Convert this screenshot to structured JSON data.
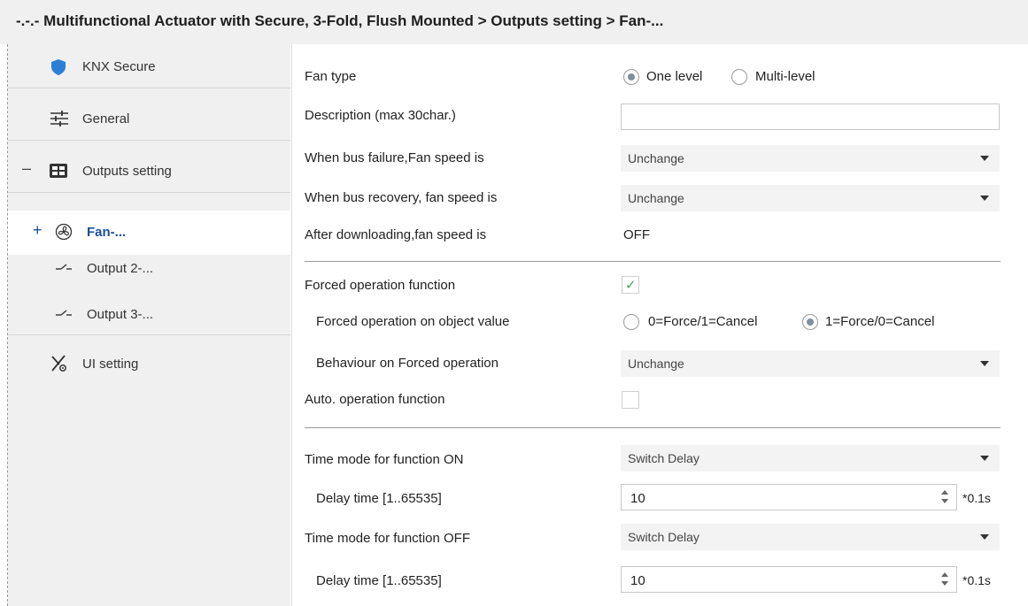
{
  "header": {
    "breadcrumb": "-.-.- Multifunctional Actuator with Secure, 3-Fold, Flush Mounted > Outputs setting > Fan-..."
  },
  "sidebar": {
    "items": [
      {
        "label": "KNX Secure",
        "icon": "shield-icon"
      },
      {
        "label": "General",
        "icon": "sliders-icon"
      },
      {
        "label": "Outputs setting",
        "icon": "grid-icon",
        "expander": "–"
      },
      {
        "label": "Fan-...",
        "icon": "fan-icon",
        "expander": "+",
        "selected": true
      },
      {
        "label": "Output 2-...",
        "icon": "switch-icon"
      },
      {
        "label": "Output 3-...",
        "icon": "switch-icon"
      },
      {
        "label": "UI setting",
        "icon": "settings-tool-icon"
      }
    ]
  },
  "form": {
    "fan_type": {
      "label": "Fan type",
      "options": [
        "One level",
        "Multi-level"
      ],
      "selected": "One level"
    },
    "description": {
      "label": "Description (max 30char.)",
      "value": ""
    },
    "bus_failure": {
      "label": "When bus failure,Fan speed is",
      "value": "Unchange"
    },
    "bus_recovery": {
      "label": "When bus recovery, fan speed is",
      "value": "Unchange"
    },
    "after_download": {
      "label": "After downloading,fan speed is",
      "value": "OFF"
    },
    "forced_function": {
      "label": "Forced operation function",
      "checked": true
    },
    "forced_object_value": {
      "label": "Forced operation on object value",
      "options": [
        "0=Force/1=Cancel",
        "1=Force/0=Cancel"
      ],
      "selected": "1=Force/0=Cancel"
    },
    "forced_behaviour": {
      "label": "Behaviour on Forced operation",
      "value": "Unchange"
    },
    "auto_function": {
      "label": "Auto. operation function",
      "checked": false
    },
    "time_mode_on": {
      "label": "Time mode for function ON",
      "value": "Switch Delay"
    },
    "delay_on": {
      "label": "Delay time [1..65535]",
      "value": "10",
      "unit": "*0.1s"
    },
    "time_mode_off": {
      "label": "Time mode for function OFF",
      "value": "Switch Delay"
    },
    "delay_off": {
      "label": "Delay time [1..65535]",
      "value": "10",
      "unit": "*0.1s"
    }
  },
  "colors": {
    "sidebar_bg": "#f0f0f0",
    "selected_text": "#1e4f9c",
    "shield": "#2c7fd6",
    "checkmark": "#4aa35a"
  }
}
